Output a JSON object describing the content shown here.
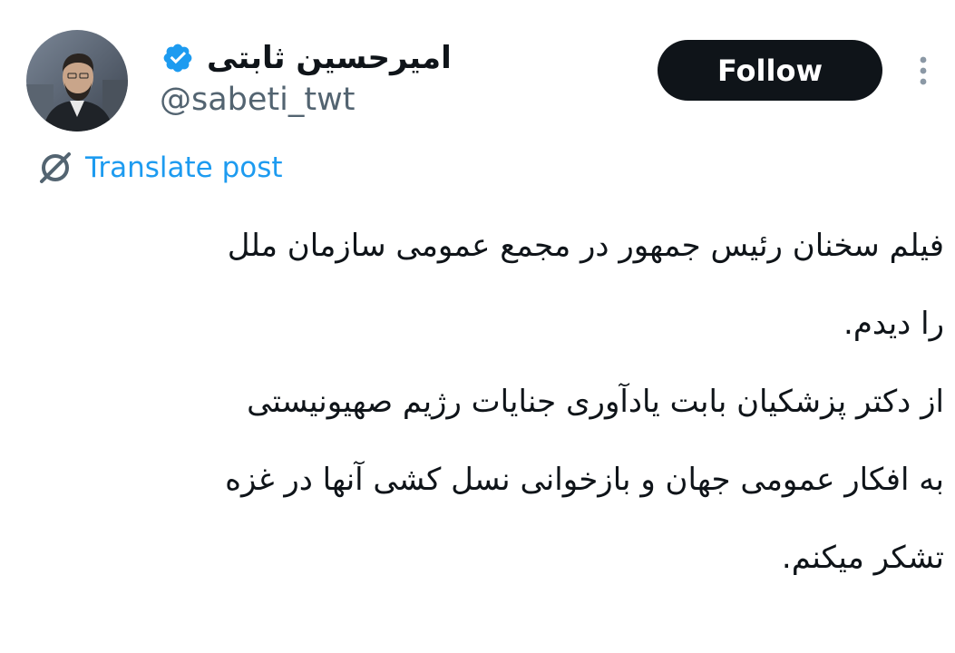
{
  "author": {
    "display_name": "امیرحسین ثابتی",
    "handle": "@sabeti_twt",
    "verified": true,
    "verified_color": "#1d9bf0"
  },
  "follow_button": {
    "label": "Follow"
  },
  "translate": {
    "label": "Translate post",
    "color": "#1d9bf0"
  },
  "post": {
    "lines": [
      "فیلم سخنان رئیس جمهور در مجمع عمومی سازمان ملل",
      "را دیدم.",
      "از دکتر پزشکیان بابت یادآوری جنایات رژیم صهیونیستی",
      "به افکار عمومی جهان و بازخوانی نسل کشی آنها در غزه",
      "تشکر میکنم."
    ]
  },
  "icons": {
    "verified": "verified-badge-icon",
    "more": "more-vertical-icon",
    "translate": "translate-globe-icon"
  }
}
